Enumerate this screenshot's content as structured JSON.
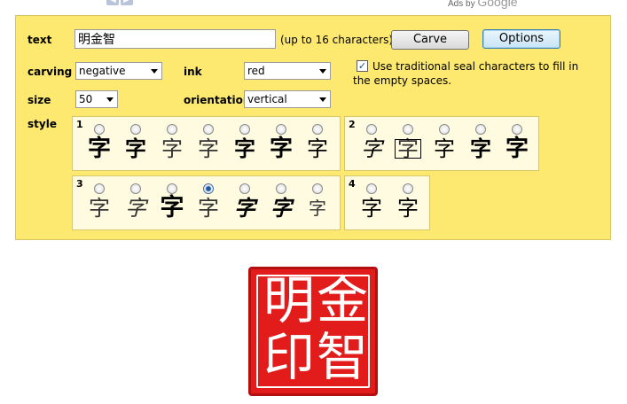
{
  "topbar": {
    "ads_label": "Ads by",
    "ads_brand": "Google"
  },
  "form": {
    "text_label": "text",
    "text_value": "明金智",
    "text_hint": "(up to 16 characters)",
    "carve_button": "Carve",
    "options_button": "Options",
    "carving_label": "carving",
    "carving_value": "negative",
    "ink_label": "ink",
    "ink_value": "red",
    "size_label": "size",
    "size_value": "50",
    "orientation_label": "orientation",
    "orientation_value": "vertical",
    "traditional_checked": true,
    "traditional_label": "Use traditional seal characters to fill in the empty spaces.",
    "style_label": "style"
  },
  "style_groups": [
    {
      "number": "1",
      "glyph": "字",
      "options": 7,
      "selected": null
    },
    {
      "number": "2",
      "glyph": "字",
      "options": 5,
      "selected": null
    },
    {
      "number": "3",
      "glyph": "字",
      "options": 7,
      "selected": 3
    },
    {
      "number": "4",
      "glyph": "字",
      "options": 2,
      "selected": null
    }
  ],
  "seal": {
    "characters": [
      "明",
      "金",
      "印",
      "智"
    ],
    "background_color": "#e21b1b",
    "ink_color": "#ffffff"
  }
}
